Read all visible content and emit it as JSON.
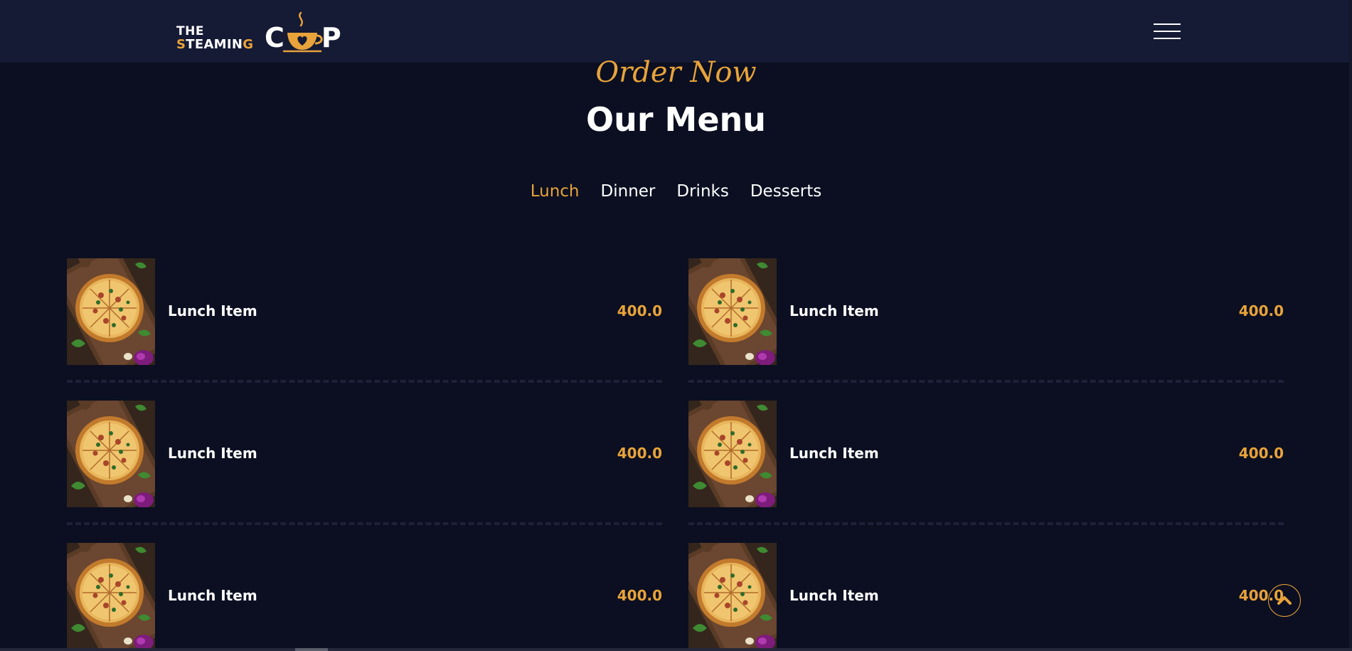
{
  "brand": {
    "line1": "THE",
    "line2_first": "S",
    "line2_mid": "TEAMIN",
    "line2_last": "G",
    "word_start": "C",
    "word_end": "P",
    "accent_color": "#e8a33a"
  },
  "nav": {
    "menu_icon": "hamburger-menu-icon"
  },
  "section": {
    "subtitle": "Order Now",
    "title": "Our Menu"
  },
  "tabs": [
    {
      "label": "Lunch",
      "active": true
    },
    {
      "label": "Dinner",
      "active": false
    },
    {
      "label": "Drinks",
      "active": false
    },
    {
      "label": "Desserts",
      "active": false
    }
  ],
  "menu_items": [
    {
      "name": "Lunch Item",
      "price": "400.0",
      "image": "pizza-image"
    },
    {
      "name": "Lunch Item",
      "price": "400.0",
      "image": "pizza-image"
    },
    {
      "name": "Lunch Item",
      "price": "400.0",
      "image": "pizza-image"
    },
    {
      "name": "Lunch Item",
      "price": "400.0",
      "image": "pizza-image"
    },
    {
      "name": "Lunch Item",
      "price": "400.0",
      "image": "pizza-image"
    },
    {
      "name": "Lunch Item",
      "price": "400.0",
      "image": "pizza-image"
    }
  ],
  "scroll_top_icon": "chevron-up-icon",
  "colors": {
    "background": "#0b0f21",
    "navbar": "#151a35",
    "accent": "#e8a33a"
  }
}
